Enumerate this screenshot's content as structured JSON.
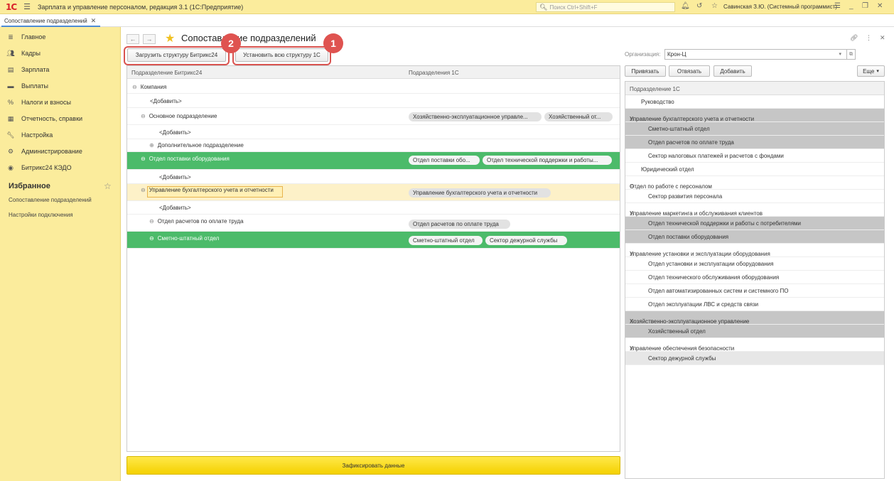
{
  "topbar": {
    "logo": "1С",
    "title": "Зарплата и управление персоналом, редакция 3.1  (1С:Предприятие)",
    "search_placeholder": "Поиск Ctrl+Shift+F",
    "user": "Савинская З.Ю. (Системный программист)"
  },
  "tabs": [
    {
      "label": "Сопоставление подразделений"
    }
  ],
  "sidebar": {
    "items": [
      {
        "label": "Главное",
        "icon": "menu-icon"
      },
      {
        "label": "Кадры",
        "icon": "people-icon"
      },
      {
        "label": "Зарплата",
        "icon": "ledger-icon"
      },
      {
        "label": "Выплаты",
        "icon": "card-icon"
      },
      {
        "label": "Налоги и взносы",
        "icon": "percent-icon"
      },
      {
        "label": "Отчетность, справки",
        "icon": "report-icon"
      },
      {
        "label": "Настройка",
        "icon": "wrench-icon"
      },
      {
        "label": "Администрирование",
        "icon": "gear-icon"
      },
      {
        "label": "Битрикс24 КЭДО",
        "icon": "bitrix-icon"
      }
    ],
    "favorites_title": "Избранное",
    "favorites": [
      {
        "label": "Сопоставление подразделений"
      },
      {
        "label": "Настройки подключения"
      }
    ]
  },
  "page": {
    "title": "Сопоставление подразделений",
    "load_button": "Загрузить структуру Битрикс24",
    "install_button": "Установить всю структуру 1С",
    "badge1": "1",
    "badge2": "2",
    "fix_button": "Зафиксировать данные"
  },
  "left_table": {
    "col1": "Подразделение Битрикс24",
    "col2": "Подразделения 1С",
    "rows": [
      {
        "label": "Компания",
        "chips": []
      },
      {
        "label": "<Добавить>",
        "chips": []
      },
      {
        "label": "Основное подразделение",
        "chips": [
          "Хозяйственно-эксплуатационное управле...",
          "Хозяйственный от..."
        ]
      },
      {
        "label": "<Добавить>",
        "chips": []
      },
      {
        "label": "Дополнительное подразделение",
        "chips": []
      },
      {
        "label": "Отдел поставки оборудования",
        "chips": [
          "Отдел поставки обо...",
          "Отдел технической поддержки и работы..."
        ]
      },
      {
        "label": "<Добавить>",
        "chips": []
      },
      {
        "label": "Управление бухгалтерского учета и отчетности",
        "chips": [
          "Управление бухгалтерского учета и отчетности"
        ]
      },
      {
        "label": "<Добавить>",
        "chips": []
      },
      {
        "label": "Отдел расчетов по оплате труда",
        "chips": [
          "Отдел расчетов по оплате труда"
        ]
      },
      {
        "label": "Сметно-штатный отдел",
        "chips": [
          "Сметно-штатный отдел",
          "Сектор дежурной службы"
        ]
      }
    ]
  },
  "right_panel": {
    "org_label": "Организация:",
    "org_value": "Крон-Ц",
    "bind_button": "Привязать",
    "unbind_button": "Отвязать",
    "add_button": "Добавить",
    "more_button": "Еще",
    "header": "Подразделение 1С",
    "rows": [
      {
        "label": "Руководство"
      },
      {
        "label": "Управление бухгалтерского учета и отчетности"
      },
      {
        "label": "Сметно-штатный отдел"
      },
      {
        "label": "Отдел расчетов по оплате труда"
      },
      {
        "label": "Сектор налоговых платежей и расчетов с фондами"
      },
      {
        "label": "Юридический отдел"
      },
      {
        "label": "Отдел по работе с персоналом"
      },
      {
        "label": "Сектор развития персонала"
      },
      {
        "label": "Управление маркетинга и обслуживания клиентов"
      },
      {
        "label": "Отдел технической поддержки и работы с потребителями"
      },
      {
        "label": "Отдел поставки оборудования"
      },
      {
        "label": "Управление установки и эксплуатации оборудования"
      },
      {
        "label": "Отдел установки и эксплуатации оборудования"
      },
      {
        "label": "Отдел технического обслуживания оборудования"
      },
      {
        "label": "Отдел автоматизированных систем и системного ПО"
      },
      {
        "label": "Отдел эксплуатации ЛВС и средств связи"
      },
      {
        "label": "Хозяйственно-эксплуатационное управление"
      },
      {
        "label": "Хозяйственный отдел"
      },
      {
        "label": "Управление обеспечения безопасности"
      },
      {
        "label": "Сектор дежурной службы"
      }
    ]
  }
}
